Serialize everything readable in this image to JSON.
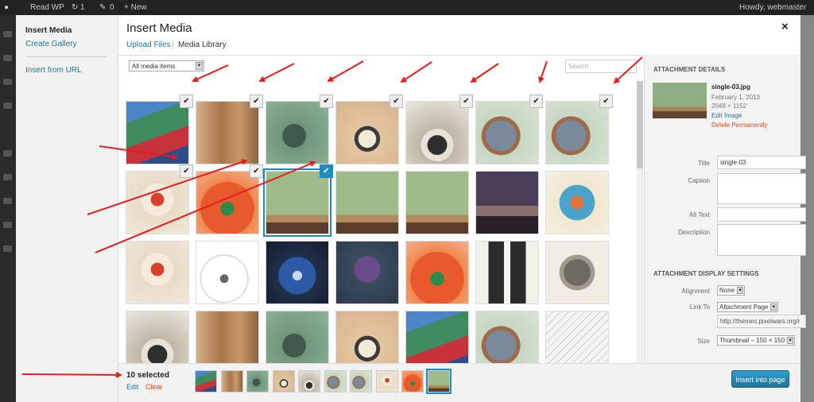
{
  "admin_bar": {
    "site": "Read WP",
    "updates": "1",
    "comments": "0",
    "new": "+ New",
    "howdy": "Howdy, webmaster"
  },
  "menu": {
    "title": "Insert Media",
    "items": [
      "Create Gallery",
      "Insert from URL"
    ]
  },
  "header": {
    "close_label": "×",
    "tabs": [
      "Upload Files",
      "Media Library"
    ]
  },
  "toolbar": {
    "filter_selected": "All media items",
    "search_placeholder": "Search"
  },
  "grid": {
    "tiles": [
      {
        "img": "superman-hulk",
        "checked": true
      },
      {
        "img": "robot-sketch",
        "checked": true
      },
      {
        "img": "green-sketch",
        "checked": true
      },
      {
        "img": "cartoon-beetle",
        "checked": true
      },
      {
        "img": "girl-on-cow",
        "checked": true
      },
      {
        "img": "elephant-deer",
        "checked": true
      },
      {
        "img": "elephant-deer",
        "checked": true
      },
      {
        "img": "flower-fairy",
        "checked": true
      },
      {
        "img": "red-hair-girl",
        "checked": true
      },
      {
        "img": "desert-scene",
        "checked": true,
        "focused": true
      },
      {
        "img": "desert-scene"
      },
      {
        "img": "desert-scene"
      },
      {
        "img": "dusk-scene"
      },
      {
        "img": "viking-girl"
      },
      {
        "img": "flower-fairy"
      },
      {
        "img": "dog-sketch"
      },
      {
        "img": "blue-machine"
      },
      {
        "img": "octopus"
      },
      {
        "img": "red-hair-girl"
      },
      {
        "img": "bw-character"
      },
      {
        "img": "gorilla-sketch"
      },
      {
        "img": "girl-on-cow"
      },
      {
        "img": "robot-sketch"
      },
      {
        "img": "green-sketch"
      },
      {
        "img": "cartoon-beetle"
      },
      {
        "img": "superman-hulk"
      },
      {
        "img": "elephant-deer"
      },
      {
        "img": "pencil-sketch"
      }
    ]
  },
  "attachment": {
    "heading": "ATTACHMENT DETAILS",
    "filename": "single-03.jpg",
    "date": "February 1, 2013",
    "dimensions": "2048 × 1152",
    "edit_link": "Edit Image",
    "delete_link": "Delete Permanently",
    "title_label": "Title",
    "title_value": "single-03",
    "caption_label": "Caption",
    "caption_value": "",
    "alt_label": "Alt Text",
    "alt_value": "",
    "description_label": "Description",
    "description_value": ""
  },
  "display": {
    "heading": "ATTACHMENT DISPLAY SETTINGS",
    "alignment_label": "Alignment",
    "alignment_value": "None",
    "link_label": "Link To",
    "link_value": "Attachment Page",
    "url_value": "http://themes.pixelwars.org/r",
    "size_label": "Size",
    "size_value": "Thumbnail – 150 × 150"
  },
  "selection": {
    "count_text": "10 selected",
    "edit_label": "Edit",
    "clear_label": "Clear",
    "strip": [
      "superman-hulk",
      "robot-sketch",
      "green-sketch",
      "cartoon-beetle",
      "girl-on-cow",
      "elephant-deer",
      "elephant-deer",
      "flower-fairy",
      "red-hair-girl",
      "desert-scene"
    ]
  },
  "insert_button": "Insert into page",
  "colors": {
    "accent": "#21759b",
    "selection_blue": "#1e8cbe",
    "delete_red": "#d54e21",
    "annotation_red": "#e81c1c"
  },
  "image_palettes": {
    "superman-hulk": "linear-gradient(160deg,#4a86c5 0 25%,#3e8b5f 25% 55%,#c8323a 55% 78%,#2d4d86 78%)",
    "robot-sketch": "linear-gradient(90deg,#d6b187,#a7774a 40%,#c99a69 70%,#8a6342)",
    "green-sketch": "radial-gradient(circle at 45% 55%,#40594a 0 24%,#6f957b 25%,#8db596 100%)",
    "cartoon-beetle": "radial-gradient(circle at 50% 60%,#f1ead8 0 18%,#3a3a3a 19% 26%,#e2c6a0 27%,#d9b28e 100%)",
    "girl-on-cow": "radial-gradient(circle at 50% 70%,#2f2f2f 0 18%,#e8e2d6 19% 30%,#bfb6a6 31%,#ece8df 100%)",
    "elephant-deer": "radial-gradient(circle at 40% 55%,#7a8a9a 0 30%,#a06a4a 31% 38%,#c6d7c3 39%,#dbe3d5 100%)",
    "flower-fairy": "radial-gradient(circle at 50% 45%,#d8402e 0 14%,#f5eadc 15% 35%,#e8dcc8 36%,#f1e8d8 100%)",
    "red-hair-girl": "radial-gradient(circle at 50% 60%,#2e8a46 0 14%,#e85a2c 15% 55%,#f08850 56%,#f5b08a 100%)",
    "desert-scene": "linear-gradient(#9dbc8a 0 70%,#b08b5e 70% 82%,#5b3b2a 82%)",
    "dusk-scene": "linear-gradient(#4b3d55 0 55%,#8a6e6e 55% 72%,#2a2028 72%)",
    "viking-girl": "radial-gradient(circle at 50% 50%,#e3733a 0 15%,#4aa3c9 16% 40%,#f0e7d0 41%,#f6efe0 100%)",
    "dog-sketch": "radial-gradient(circle at 45% 60%,#666 0 8%,#fff 9% 45%,#ddd 46% 48%,#fff 49%)",
    "blue-machine": "radial-gradient(circle at 50% 55%,#c9d7ec 0 10%,#2d5aa6 11% 40%,#20304a 41%,#151c2e 100%)",
    "octopus": "radial-gradient(circle at 50% 45%,#6a4c8a 0 28%,#3b4c5f 29%,#2c3a4a 100%)",
    "bw-character": "linear-gradient(90deg,#f1f1ee 0 20%,#2b2b2b 20% 45%,#f4f4f0 45% 55%,#2b2b2b 55% 80%,#f1f1ee 80%)",
    "gorilla-sketch": "radial-gradient(circle at 50% 50%,#6d6a63 0 30%,#a29a8c 31% 40%,#f1ede4 41%)",
    "pencil-sketch": "repeating-linear-gradient(135deg,#f4f4f4 0 6px,#cfcfcf 6px 7px)"
  }
}
